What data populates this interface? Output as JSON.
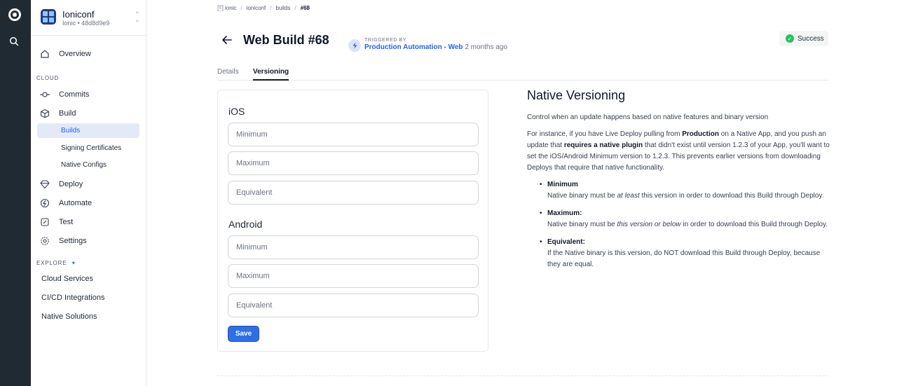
{
  "sidebar": {
    "org": {
      "name": "Ioniconf",
      "subtitle": "Ionic • 48d8d9e9"
    },
    "overview": "Overview",
    "cloud_label": "CLOUD",
    "cloud_items": {
      "commits": "Commits",
      "build": "Build",
      "builds": "Builds",
      "signing": "Signing Certificates",
      "native_configs": "Native Configs",
      "deploy": "Deploy",
      "automate": "Automate",
      "test": "Test",
      "settings": "Settings"
    },
    "explore_label": "EXPLORE",
    "explore_items": {
      "cloud_services": "Cloud Services",
      "cicd": "CI/CD Integrations",
      "native_solutions": "Native Solutions"
    }
  },
  "breadcrumb": {
    "org": "ionic",
    "app": "ioniconf",
    "section": "builds",
    "current": "#68",
    "sep": "/"
  },
  "header": {
    "title": "Web Build #68",
    "triggered_label": "TRIGGERED BY",
    "triggered_by": "Production Automation - Web",
    "triggered_when": "2 months ago",
    "status": "Success"
  },
  "tabs": {
    "details": "Details",
    "versioning": "Versioning"
  },
  "form": {
    "ios_title": "iOS",
    "android_title": "Android",
    "placeholders": {
      "minimum": "Minimum",
      "maximum": "Maximum",
      "equivalent": "Equivalent"
    },
    "save": "Save"
  },
  "help": {
    "title": "Native Versioning",
    "intro": "Control when an update happens based on native features and binary version",
    "p2_a": "For instance, if you have Live Deploy pulling from ",
    "p2_b": "Production",
    "p2_c": " on a Native App, and you push an update that ",
    "p2_d": "requires a native plugin",
    "p2_e": " that didn't exist until version 1.2.3 of your App, you'll want to set the iOS/Android Minimum version to 1.2.3. This prevents earlier versions from downloading Deploys that require that native functionality.",
    "min_term": "Minimum",
    "min_a": "Native binary must be ",
    "min_b": "at least",
    "min_c": " this version in order to download this Build through Deploy.",
    "max_term": "Maximum:",
    "max_a": "Native binary must be ",
    "max_b": "this version or below",
    "max_c": " in order to download this Build through Deploy.",
    "eq_term": "Equivalent:",
    "eq_text": "If the Native binary is this version, do NOT download this Build through Deploy, because they are equal."
  },
  "colors": {
    "accent": "#2563eb",
    "rail": "#1f2a33",
    "success": "#22c55e",
    "active_bg": "#e4e9f8"
  }
}
